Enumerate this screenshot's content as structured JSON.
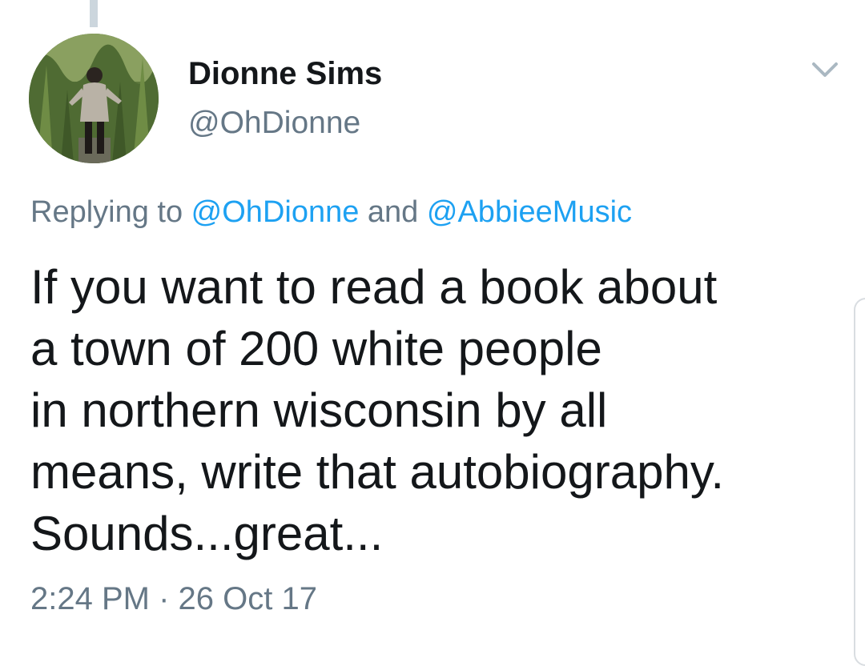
{
  "tweet": {
    "author_name": "Dionne Sims",
    "author_handle": "@OhDionne",
    "replying_prefix": "Replying to ",
    "reply_mention_1": "@OhDionne",
    "reply_connector": " and ",
    "reply_mention_2": "@AbbieeMusic",
    "text_lines": [
      "If you want to read a book about",
      "a town of 200 white people",
      "in northern wisconsin by all",
      "means, write that autobiography.",
      "Sounds...great..."
    ],
    "time": "2:24 PM",
    "separator": " · ",
    "date": "26 Oct 17"
  },
  "icons": {
    "menu": "chevron-down-icon",
    "avatar": "profile-photo"
  },
  "colors": {
    "text": "#14171a",
    "secondary": "#657786",
    "link": "#1da1f2",
    "thread_line": "#ccd6dd"
  }
}
